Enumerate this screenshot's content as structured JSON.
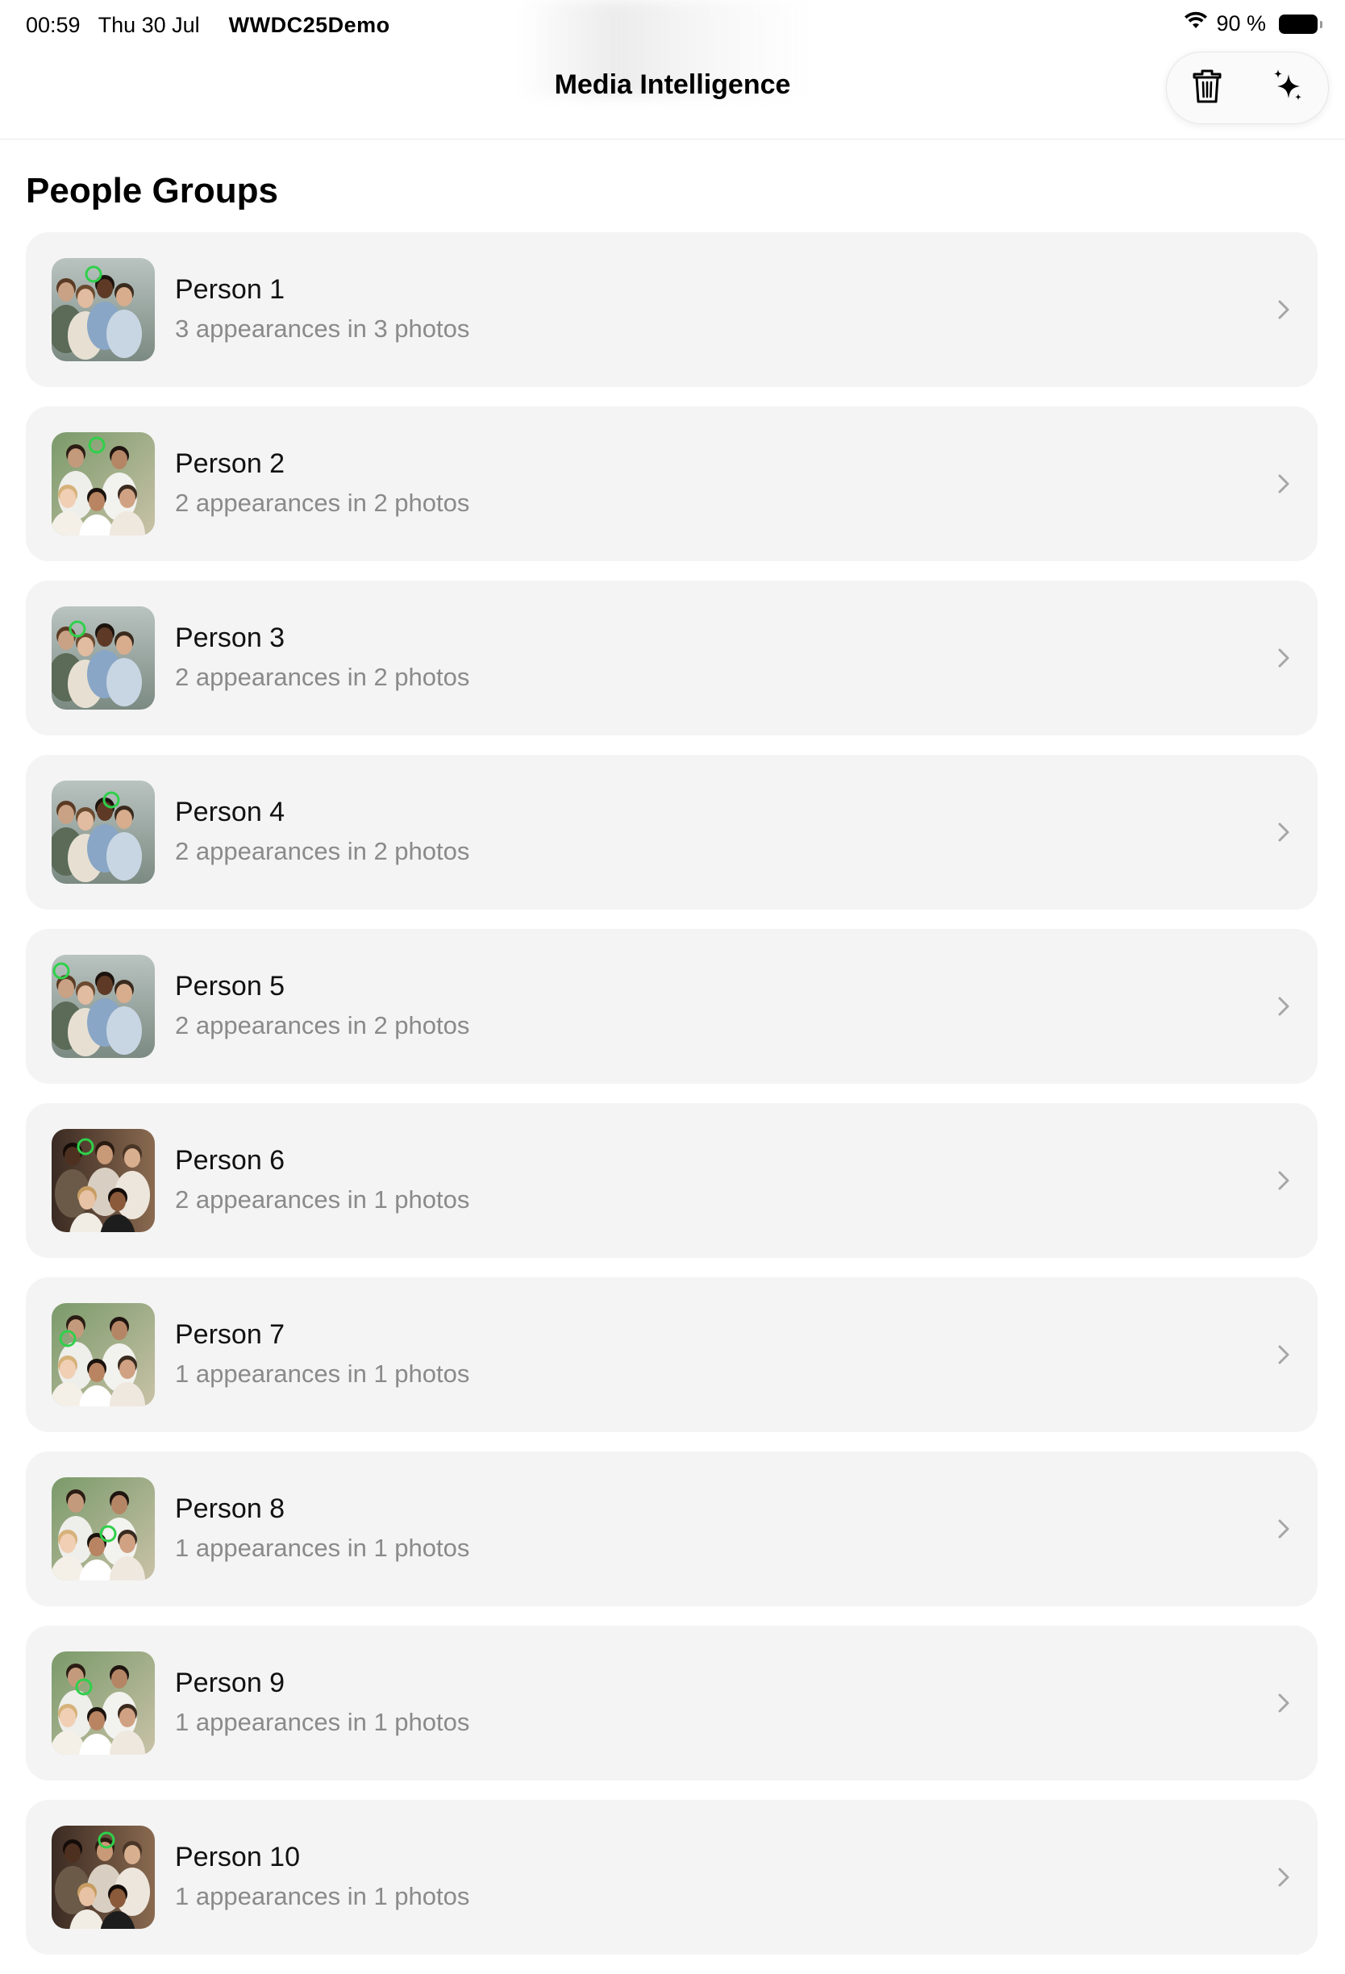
{
  "status_bar": {
    "time": "00:59",
    "date": "Thu 30 Jul",
    "app_name": "WWDC25Demo",
    "battery_text": "90 %"
  },
  "nav": {
    "title": "Media Intelligence",
    "trash_icon": "trash-icon",
    "sparkle_icon": "sparkles-icon"
  },
  "section": {
    "title": "People Groups"
  },
  "rows": [
    {
      "title": "Person 1",
      "subtitle": "3 appearances in 3 photos",
      "photo": "group-photo-a"
    },
    {
      "title": "Person 2",
      "subtitle": "2 appearances in 2 photos",
      "photo": "group-photo-b"
    },
    {
      "title": "Person 3",
      "subtitle": "2 appearances in 2 photos",
      "photo": "group-photo-a"
    },
    {
      "title": "Person 4",
      "subtitle": "2 appearances in 2 photos",
      "photo": "group-photo-a"
    },
    {
      "title": "Person 5",
      "subtitle": "2 appearances in 2 photos",
      "photo": "group-photo-a"
    },
    {
      "title": "Person 6",
      "subtitle": "2 appearances in 1 photos",
      "photo": "group-photo-c"
    },
    {
      "title": "Person 7",
      "subtitle": "1 appearances in 1 photos",
      "photo": "group-photo-b"
    },
    {
      "title": "Person 8",
      "subtitle": "1 appearances in 1 photos",
      "photo": "group-photo-b"
    },
    {
      "title": "Person 9",
      "subtitle": "1 appearances in 1 photos",
      "photo": "group-photo-b"
    },
    {
      "title": "Person 10",
      "subtitle": "1 appearances in 1 photos",
      "photo": "group-photo-c"
    }
  ],
  "colors": {
    "row_background": "#f4f4f4",
    "subtitle": "#8a8a8a",
    "face_marker": "#2fd04a"
  }
}
